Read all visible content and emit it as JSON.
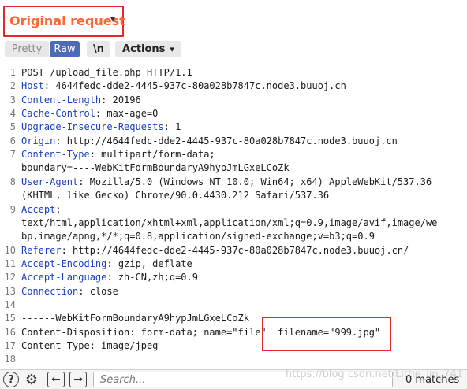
{
  "header": {
    "title": "Original request",
    "title_color": "#ff6633",
    "highlight_color": "#e8252a"
  },
  "toolbar": {
    "pretty_label": "Pretty",
    "raw_label": "Raw",
    "newline_label": "\\n",
    "actions_label": "Actions",
    "active_accent": "#4c6ab5"
  },
  "request_lines": [
    {
      "num": "1",
      "key": "",
      "text": "POST /upload_file.php HTTP/1.1"
    },
    {
      "num": "2",
      "key": "Host",
      "text": ": 4644fedc-dde2-4445-937c-80a028b7847c.node3.buuoj.cn"
    },
    {
      "num": "3",
      "key": "Content-Length",
      "text": ": 20196"
    },
    {
      "num": "4",
      "key": "Cache-Control",
      "text": ": max-age=0"
    },
    {
      "num": "5",
      "key": "Upgrade-Insecure-Requests",
      "text": ": 1"
    },
    {
      "num": "6",
      "key": "Origin",
      "text": ": http://4644fedc-dde2-4445-937c-80a028b7847c.node3.buuoj.cn"
    },
    {
      "num": "7",
      "key": "Content-Type",
      "text": ": multipart/form-data;"
    },
    {
      "num": "",
      "key": "",
      "text": "boundary=----WebKitFormBoundaryA9hypJmLGxeLCoZk"
    },
    {
      "num": "8",
      "key": "User-Agent",
      "text": ": Mozilla/5.0 (Windows NT 10.0; Win64; x64) AppleWebKit/537.36"
    },
    {
      "num": "",
      "key": "",
      "text": "(KHTML, like Gecko) Chrome/90.0.4430.212 Safari/537.36"
    },
    {
      "num": "9",
      "key": "Accept",
      "text": ":"
    },
    {
      "num": "",
      "key": "",
      "text": "text/html,application/xhtml+xml,application/xml;q=0.9,image/avif,image/we"
    },
    {
      "num": "",
      "key": "",
      "text": "bp,image/apng,*/*;q=0.8,application/signed-exchange;v=b3;q=0.9"
    },
    {
      "num": "10",
      "key": "Referer",
      "text": ": http://4644fedc-dde2-4445-937c-80a028b7847c.node3.buuoj.cn/"
    },
    {
      "num": "11",
      "key": "Accept-Encoding",
      "text": ": gzip, deflate"
    },
    {
      "num": "12",
      "key": "Accept-Language",
      "text": ": zh-CN,zh;q=0.9"
    },
    {
      "num": "13",
      "key": "Connection",
      "text": ": close"
    },
    {
      "num": "14",
      "key": "",
      "text": ""
    },
    {
      "num": "15",
      "key": "",
      "text": "------WebKitFormBoundaryA9hypJmLGxeLCoZk"
    },
    {
      "num": "16",
      "key": "",
      "text": "Content-Disposition: form-data; name=\"file\"  filename=\"999.jpg\""
    },
    {
      "num": "17",
      "key": "",
      "text": "Content-Type: image/jpeg"
    },
    {
      "num": "18",
      "key": "",
      "text": ""
    }
  ],
  "bottom": {
    "help_icon": "?",
    "search_placeholder": "Search...",
    "matches_label": "0 matches",
    "watermark": "https://blog.csdn.net/Little_lin_741"
  }
}
